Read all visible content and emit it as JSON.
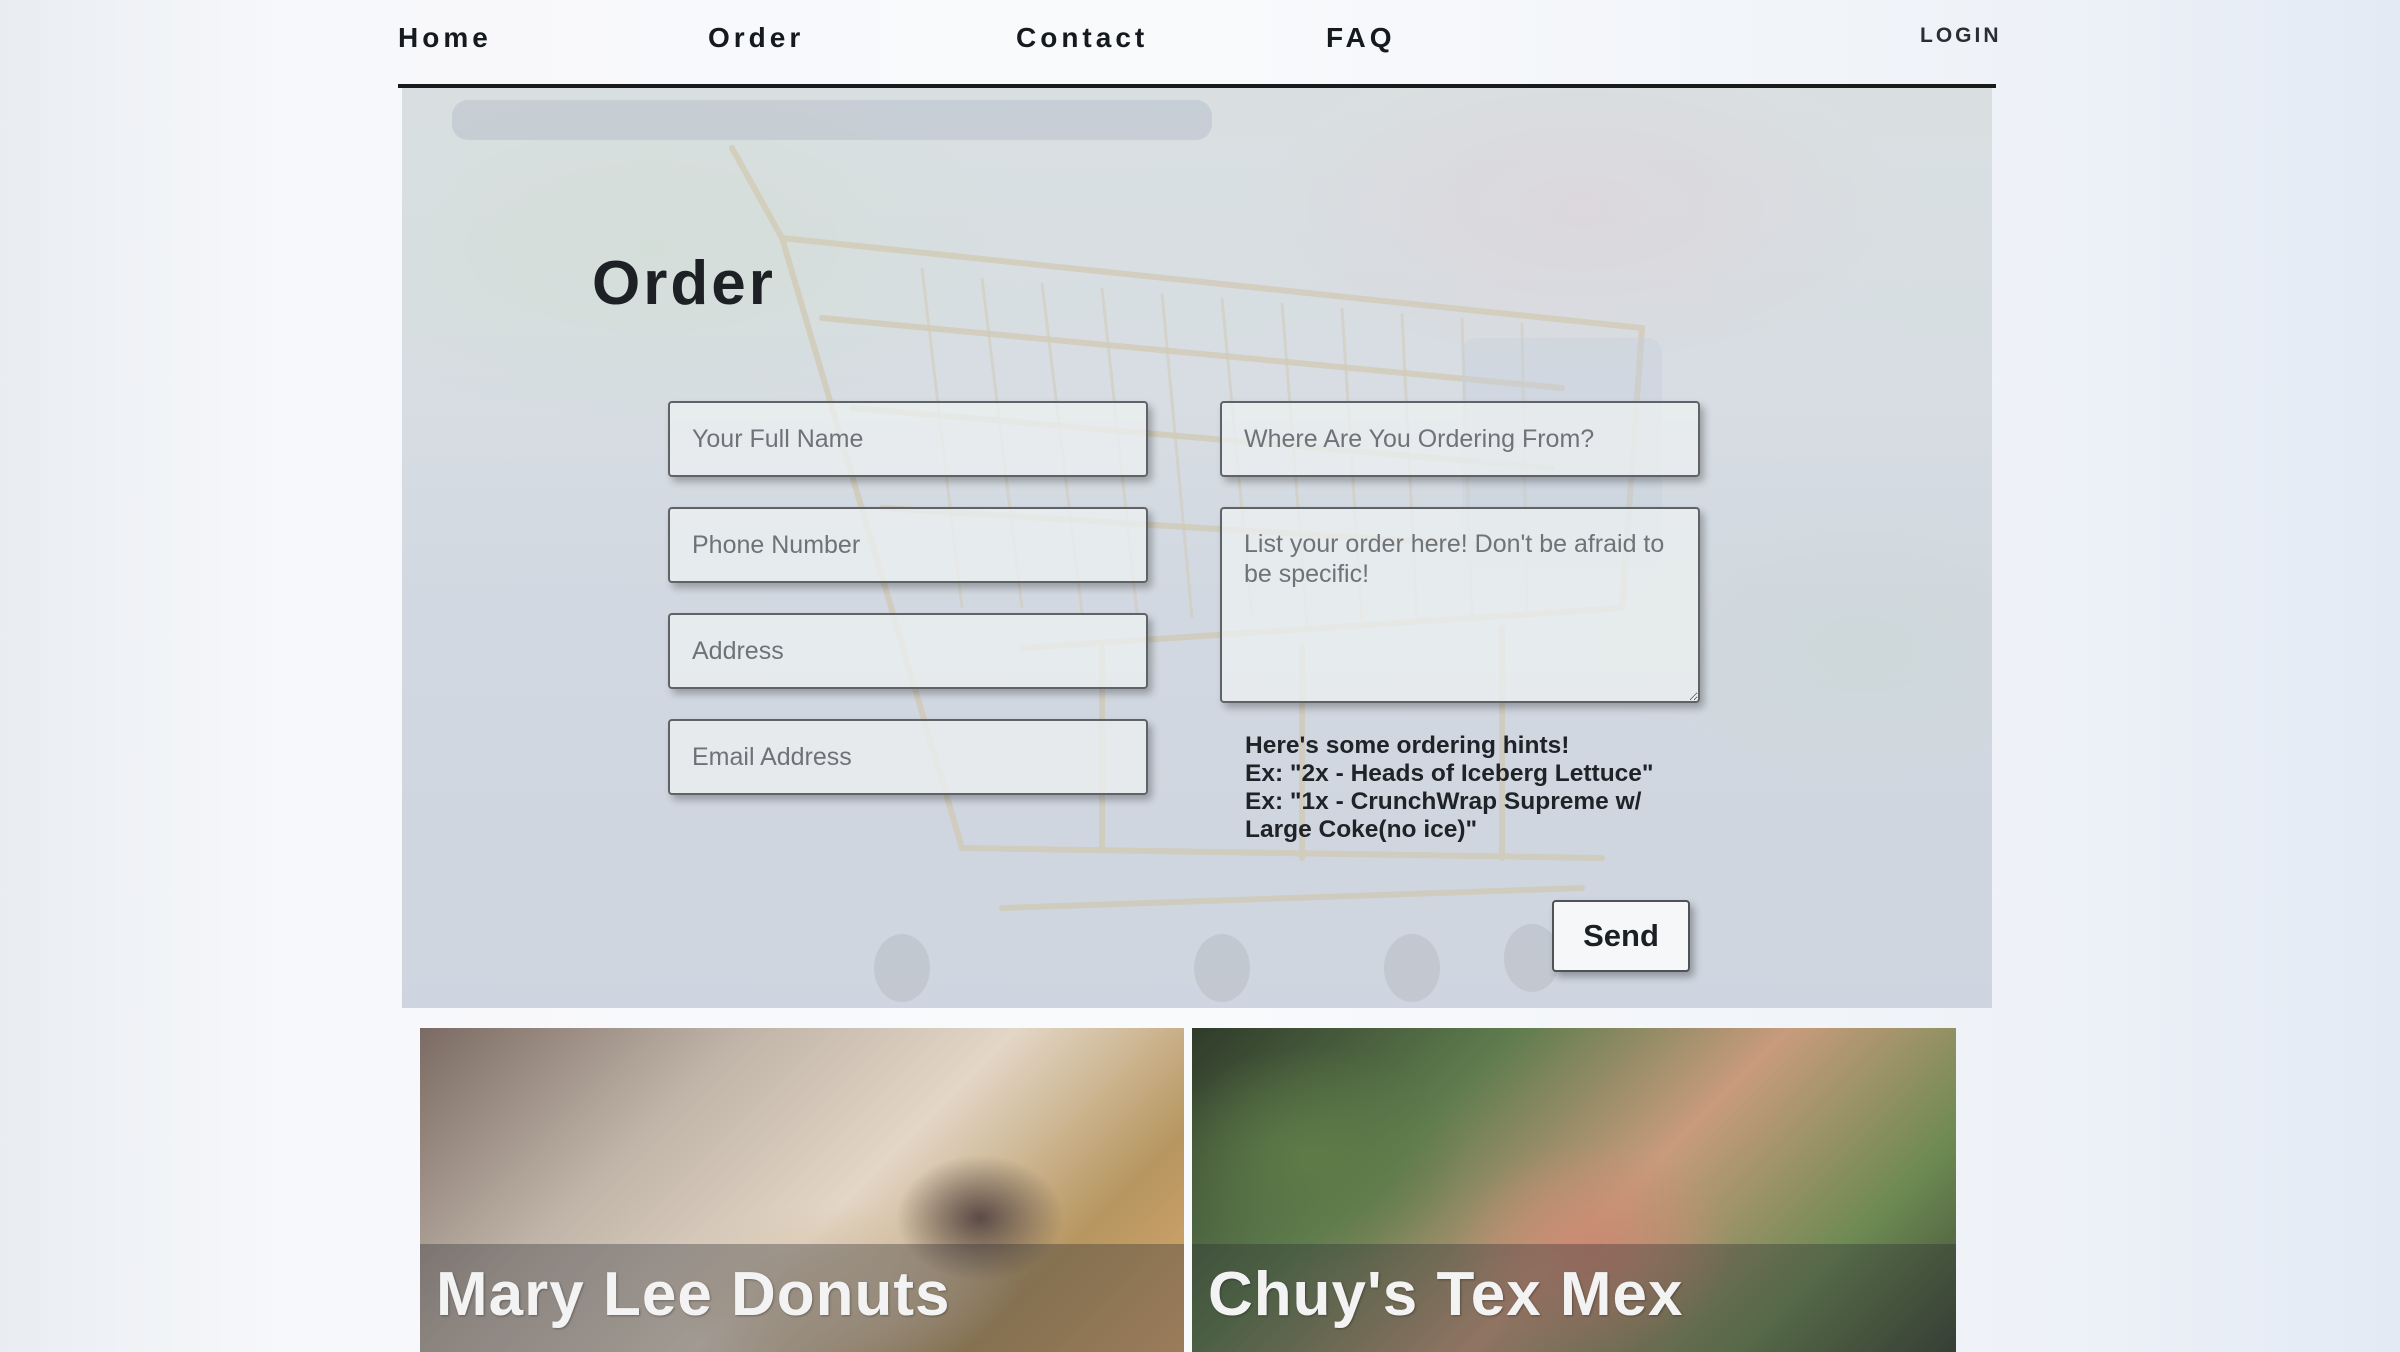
{
  "nav": {
    "items": [
      "Home",
      "Order",
      "Contact",
      "FAQ"
    ],
    "login_label": "LOGIN"
  },
  "order": {
    "title": "Order",
    "fields": {
      "full_name_placeholder": "Your Full Name",
      "phone_placeholder": "Phone Number",
      "address_placeholder": "Address",
      "email_placeholder": "Email Address",
      "ordering_from_placeholder": "Where Are You Ordering From?",
      "order_list_placeholder": "List your order here! Don't be afraid to be specific!"
    },
    "hints": {
      "line1": "Here's some ordering hints!",
      "line2": "Ex: \"2x - Heads of Iceberg Lettuce\"",
      "line3": "Ex: \"1x - CrunchWrap Supreme w/",
      "line4": "Large Coke(no ice)\""
    },
    "send_label": "Send"
  },
  "cards": [
    {
      "title": "Mary Lee Donuts"
    },
    {
      "title": "Chuy's Tex Mex"
    }
  ]
}
